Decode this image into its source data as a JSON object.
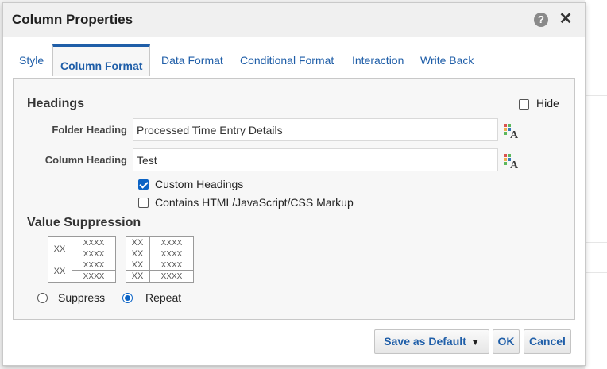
{
  "dialog": {
    "title": "Column Properties",
    "help_glyph": "?",
    "close_glyph": "✕"
  },
  "tabs": [
    {
      "label": "Style"
    },
    {
      "label": "Column Format",
      "active": true
    },
    {
      "label": "Data Format"
    },
    {
      "label": "Conditional Format"
    },
    {
      "label": "Interaction"
    },
    {
      "label": "Write Back"
    }
  ],
  "headings": {
    "title": "Headings",
    "hide_label": "Hide",
    "hide_checked": false,
    "folder_heading_label": "Folder Heading",
    "folder_heading_value": "Processed Time Entry Details",
    "column_heading_label": "Column Heading",
    "column_heading_value": "Test",
    "custom_headings_label": "Custom Headings",
    "custom_headings_checked": true,
    "contains_markup_label": "Contains HTML/JavaScript/CSS Markup",
    "contains_markup_checked": false
  },
  "value_suppression": {
    "title": "Value Suppression",
    "suppress_label": "Suppress",
    "repeat_label": "Repeat",
    "selected": "Repeat",
    "sample_short": "XX",
    "sample_long": "XXXX"
  },
  "footer": {
    "save_default_label": "Save as Default",
    "ok_label": "OK",
    "cancel_label": "Cancel"
  },
  "colors": {
    "accent": "#1f5ea8",
    "check_blue": "#0b63c5"
  }
}
